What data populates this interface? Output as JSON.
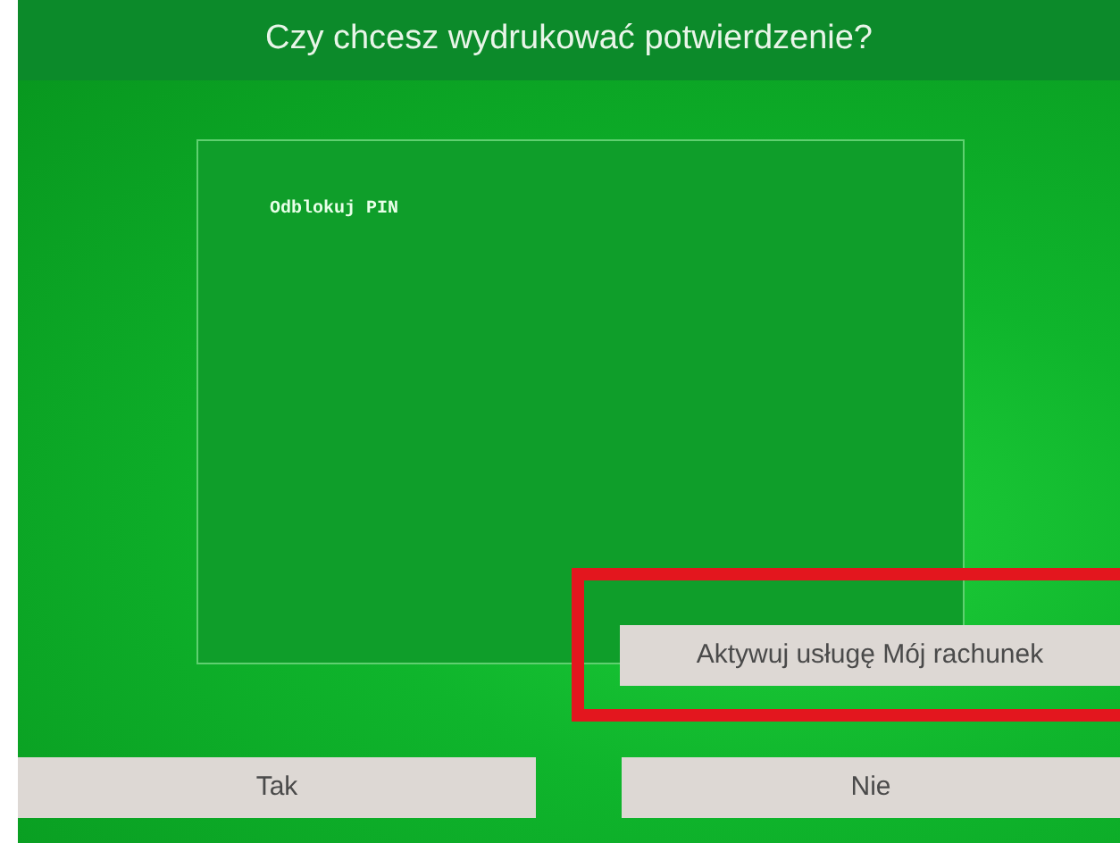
{
  "header": {
    "title": "Czy chcesz wydrukować potwierdzenie?"
  },
  "receipt": {
    "text": "Odblokuj PIN"
  },
  "action_button": {
    "label": "Aktywuj usługę Mój rachunek",
    "highlighted": true
  },
  "buttons": [
    {
      "label": "Tak"
    },
    {
      "label": "Nie"
    }
  ]
}
